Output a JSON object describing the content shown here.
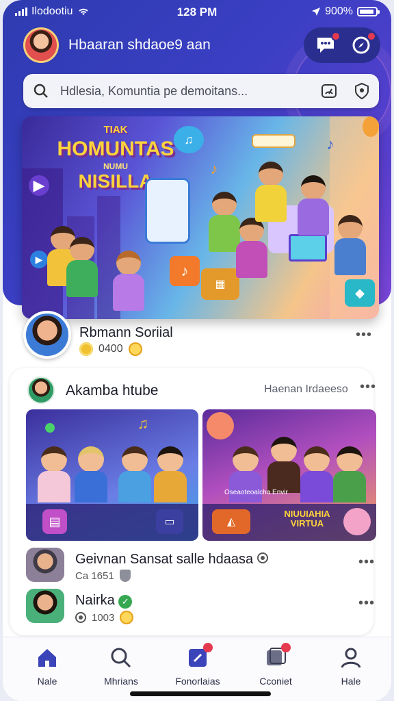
{
  "status_bar": {
    "carrier": "Ilodootiu",
    "time": "128 PM",
    "battery": "900%"
  },
  "header": {
    "greeting": "Hbaaran shdaoe9 aan",
    "chat_badge": "",
    "compass_badge": ""
  },
  "search": {
    "placeholder": "Hdlesia, Komuntia pe demoitans..."
  },
  "hero": {
    "line1": "TIAK",
    "line2": "HOMUNTAS",
    "line3": "NUMU",
    "line4": "NISILLA"
  },
  "featured": {
    "name": "Rbmann Soriial",
    "points": "0400"
  },
  "group": {
    "title": "Akamba htube",
    "subtitle": "Haenan Irdaeeso",
    "thumb1_caption": "",
    "thumb2_caption": "Oseaoteoalcha Envir",
    "thumb2_title_1": "NIUUIAHIA",
    "thumb2_title_2": "VIRTUA"
  },
  "list": [
    {
      "name": "Geivnan Sansat salle hdaasa",
      "meta": "Ca 1651"
    },
    {
      "name": "Nairka",
      "meta": "1003"
    }
  ],
  "nav": [
    {
      "label": "Nale",
      "icon": "home-icon"
    },
    {
      "label": "Mhrians",
      "icon": "search-icon"
    },
    {
      "label": "Fonorlaias",
      "icon": "bookmark-icon"
    },
    {
      "label": "Cconiet",
      "icon": "messages-icon"
    },
    {
      "label": "Hale",
      "icon": "profile-icon"
    }
  ],
  "colors": {
    "header_gradient_start": "#2e3bb0",
    "header_gradient_end": "#7b45d8",
    "nav_active": "#3b44b8",
    "badge": "#e53950"
  }
}
